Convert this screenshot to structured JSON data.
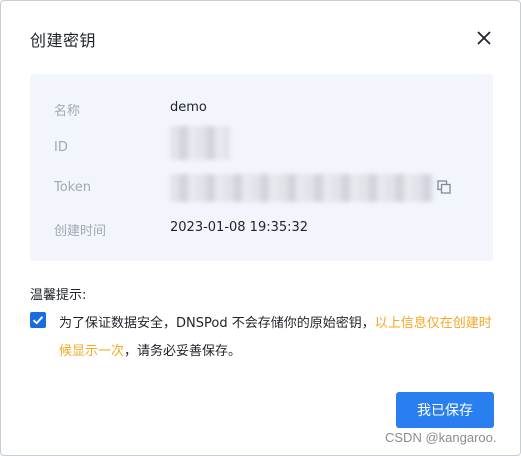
{
  "dialog": {
    "title": "创建密钥",
    "close_icon": "close-icon"
  },
  "info": {
    "name_label": "名称",
    "name_value": "demo",
    "id_label": "ID",
    "token_label": "Token",
    "created_label": "创建时间",
    "created_value": "2023-01-08 19:35:32",
    "copy_icon": "copy-icon"
  },
  "tips": {
    "title": "温馨提示:",
    "checked": true,
    "text_part1": "为了保证数据安全，DNSPod 不会存储你的原始密钥，",
    "highlight": "以上信息仅在创建时候显示一次",
    "text_part2": "，请务必妥善保存。"
  },
  "footer": {
    "save_button": "我已保存"
  },
  "watermark": "CSDN @kangaroo.",
  "colors": {
    "primary": "#2a7ff0",
    "highlight": "#f5a623",
    "panel_bg": "#f2f6fc",
    "label": "#a0a8b4"
  }
}
